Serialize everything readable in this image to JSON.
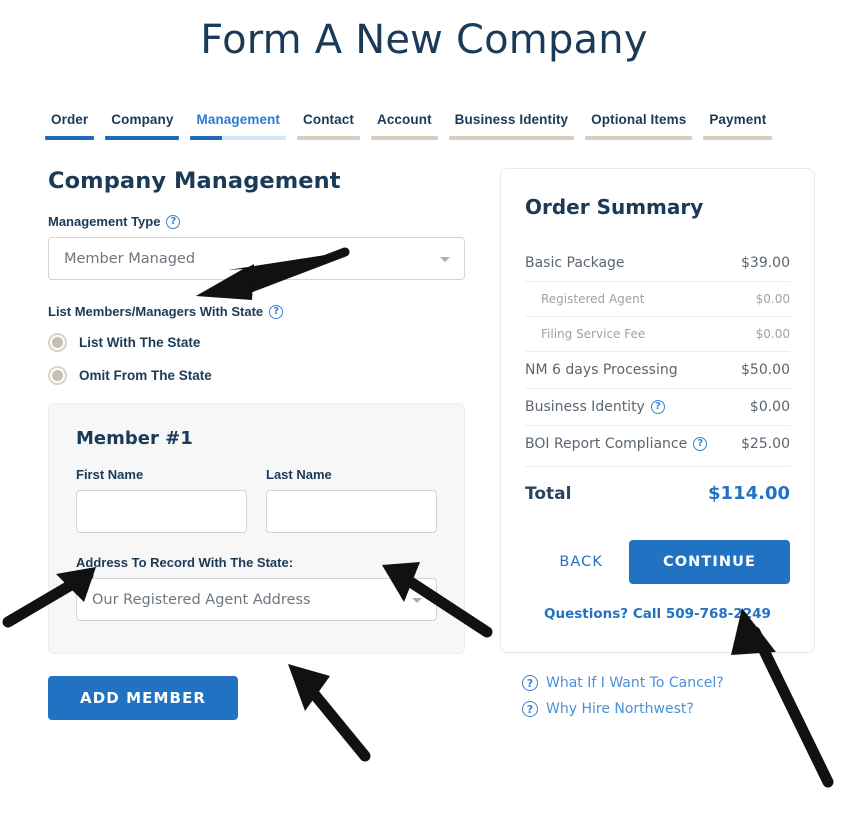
{
  "page": {
    "title": "Form A New Company"
  },
  "tabs": [
    {
      "label": "Order",
      "state": "done",
      "active": false
    },
    {
      "label": "Company",
      "state": "done",
      "active": false
    },
    {
      "label": "Management",
      "state": "partial",
      "active": true,
      "progress_pct": 33
    },
    {
      "label": "Contact",
      "state": "todo",
      "active": false
    },
    {
      "label": "Account",
      "state": "todo",
      "active": false
    },
    {
      "label": "Business Identity",
      "state": "todo",
      "active": false
    },
    {
      "label": "Optional Items",
      "state": "todo",
      "active": false
    },
    {
      "label": "Payment",
      "state": "todo",
      "active": false
    }
  ],
  "form": {
    "heading": "Company Management",
    "management_type": {
      "label": "Management Type",
      "help_icon": "question-circle-icon",
      "value": "Member Managed",
      "caret_icon": "caret-down-icon"
    },
    "list_with_state": {
      "label": "List Members/Managers With State",
      "help_icon": "question-circle-icon",
      "options": [
        {
          "label": "List With The State",
          "selected": false
        },
        {
          "label": "Omit From The State",
          "selected": false
        }
      ]
    },
    "member": {
      "title": "Member #1",
      "first_name_label": "First Name",
      "first_name_value": "",
      "last_name_label": "Last Name",
      "last_name_value": "",
      "address_label": "Address To Record With The State:",
      "address_value": "Our Registered Agent Address",
      "caret_icon": "caret-down-icon"
    },
    "add_member_label": "ADD MEMBER"
  },
  "summary": {
    "title": "Order Summary",
    "rows": [
      {
        "label": "Basic Package",
        "amount": "$39.00",
        "sub": false,
        "help": false
      },
      {
        "label": "Registered Agent",
        "amount": "$0.00",
        "sub": true,
        "help": false
      },
      {
        "label": "Filing Service Fee",
        "amount": "$0.00",
        "sub": true,
        "help": false
      },
      {
        "label": "NM 6 days Processing",
        "amount": "$50.00",
        "sub": false,
        "help": false
      },
      {
        "label": "Business Identity",
        "amount": "$0.00",
        "sub": false,
        "help": true
      },
      {
        "label": "BOI Report Compliance",
        "amount": "$25.00",
        "sub": false,
        "help": true
      }
    ],
    "total_label": "Total",
    "total_amount": "$114.00",
    "back_label": "BACK",
    "continue_label": "CONTINUE",
    "phone_text": "Questions? Call 509-768-2249"
  },
  "help_links": [
    {
      "icon": "question-circle-icon",
      "label": "What If I Want To Cancel?"
    },
    {
      "icon": "question-circle-icon",
      "label": "Why Hire Northwest?"
    }
  ],
  "colors": {
    "accent_blue": "#2272c4",
    "active_tab_blue": "#2b7cd3",
    "dark_navy": "#1b3a57",
    "incomplete_tab": "#d9cdc0",
    "partial_tab_track": "#d6e7f8",
    "border_tan": "#ddd2c6",
    "panel_gray": "#f7f7f7"
  },
  "annotations": {
    "arrow_count": 5,
    "targets": [
      "management-type-select",
      "first-name-input",
      "last-name-input",
      "address-select",
      "continue-button"
    ]
  }
}
